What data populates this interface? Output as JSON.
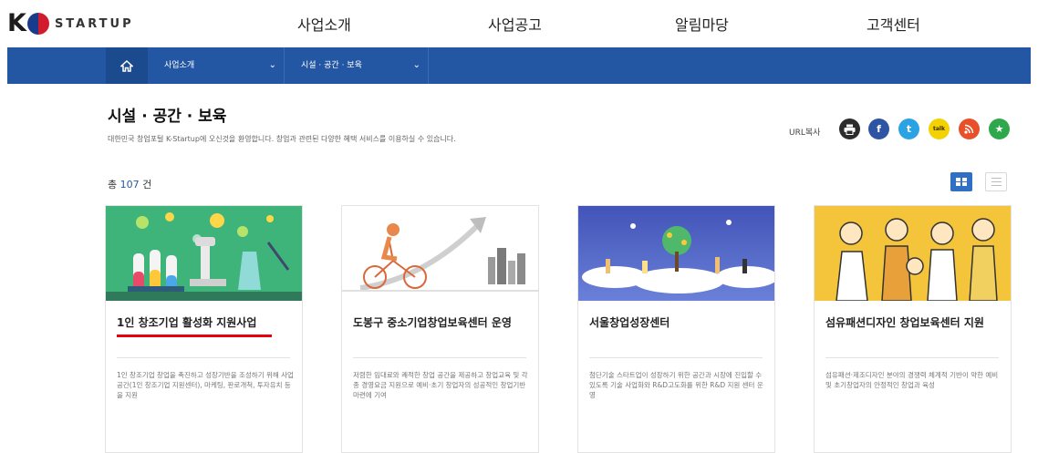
{
  "logo": {
    "k": "K",
    "text": "STARTUP"
  },
  "gnb": [
    "사업소개",
    "사업공고",
    "알림마당",
    "고객센터"
  ],
  "breadcrumb": {
    "home_icon": "home-icon",
    "level1": "사업소개",
    "level2": "시설 · 공간 · 보육",
    "chevron": "⌄"
  },
  "page": {
    "title": "시설 · 공간 · 보육",
    "description": "대한민국 창업포털 K-Startup에 오신것을 환영합니다. 창업과 관련된 다양한 혜택 서비스를 이용하실 수 있습니다."
  },
  "share": {
    "url_copy": "URL복사",
    "icons": [
      {
        "name": "print-icon",
        "glyph": "⎙"
      },
      {
        "name": "facebook-icon",
        "glyph": "f"
      },
      {
        "name": "twitter-icon",
        "glyph": "t"
      },
      {
        "name": "kakao-icon",
        "glyph": "talk"
      },
      {
        "name": "rss-icon",
        "glyph": "◉"
      },
      {
        "name": "bookmark-icon",
        "glyph": "★"
      }
    ]
  },
  "list": {
    "total_prefix": "총",
    "total_count": "107",
    "total_suffix": "건"
  },
  "cards": [
    {
      "title": "1인 창조기업 활성화 지원사업",
      "description": "1인 창조기업 창업을 촉진하고 성장기반을 조성하기 위해 사업공간(1인 창조기업 지원센터), 마케팅, 판로개척, 투자유치 등을 지원"
    },
    {
      "title": "도봉구 중소기업창업보육센터 운영",
      "description": "저렴한 임대료와 쾌적한 창업 공간을 제공하고 창업교육 및 각종 경영요금 지원으로 예비·초기 창업자의 성공적인 창업기반 마련에 기여"
    },
    {
      "title": "서울창업성장센터",
      "description": "첨단기술 스타트업이 성장하기 위한 공간과 시장에 진입할 수 있도록 기술 사업화와 R&D고도화를 위한 R&D 지원 센터 운영"
    },
    {
      "title": "섬유패션디자인 창업보육센터 지원",
      "description": "섬유패션·제조디자인 분야의 경쟁력 체계적 기반이 약한 예비 및 초기창업자의 안정적인 창업과 육성"
    }
  ],
  "colors": {
    "primary_blue": "#2457a3",
    "highlight_red": "#e8000b"
  }
}
